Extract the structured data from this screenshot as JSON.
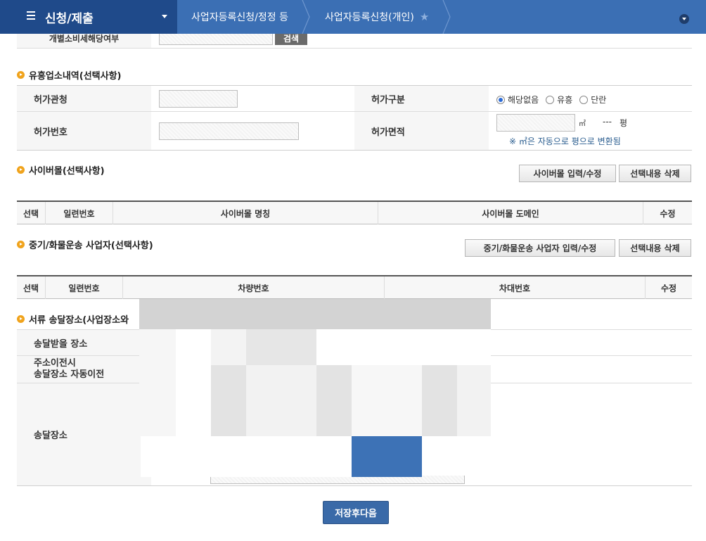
{
  "nav": {
    "menu_label": "신청/제출",
    "crumb1": "사업자등록신청/정정 등",
    "crumb2": "사업자등록신청(개인)"
  },
  "top_partial": {
    "label": "개별소비세해당여부",
    "button": "검색"
  },
  "entertainment": {
    "title": "유흥업소내역(선택사항)",
    "permit_office_label": "허가관청",
    "permit_type_label": "허가구분",
    "permit_options": [
      "해당없음",
      "유흥",
      "단란"
    ],
    "permit_selected": "해당없음",
    "permit_number_label": "허가번호",
    "permit_area_label": "허가면적",
    "area_unit": "㎡",
    "pyeong_value": "---",
    "pyeong_unit": "평",
    "area_note": "※ ㎡은 자동으로 평으로 변환됨"
  },
  "cybermall": {
    "title": "사이버몰(선택사항)",
    "input_button": "사이버몰 입력/수정",
    "delete_button": "선택내용 삭제",
    "columns": [
      "선택",
      "일련번호",
      "사이버몰 명칭",
      "사이버몰 도메인",
      "수정"
    ]
  },
  "heavy": {
    "title": "중기/화물운송 사업자(선택사항)",
    "input_button": "중기/화물운송 사업자 입력/수정",
    "delete_button": "선택내용 삭제",
    "columns": [
      "선택",
      "일련번호",
      "차량번호",
      "차대번호",
      "수정"
    ]
  },
  "delivery": {
    "title": "서류 송달장소(사업장소와",
    "receive_place_label": "송달받을 장소",
    "auto_move_label_1": "주소이전시",
    "auto_move_label_2": "송달장소 자동이전",
    "place_label": "송달장소"
  },
  "footer": {
    "save_next": "저장후다음"
  },
  "colors": {
    "nav_bg": "#3b6fb4",
    "nav_dark": "#1f4a8a",
    "bullet": "#f0a31c",
    "save_btn": "#3a6aa8"
  }
}
